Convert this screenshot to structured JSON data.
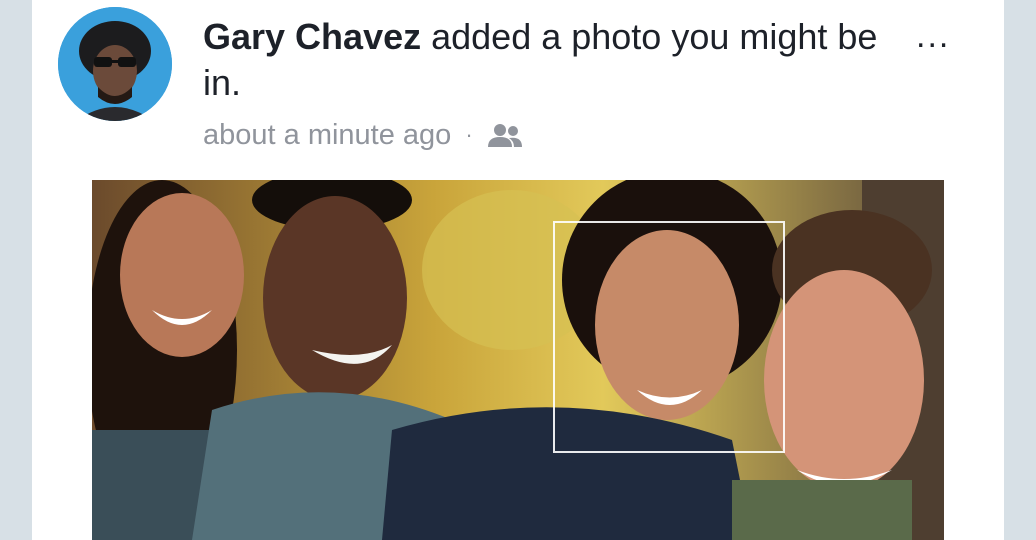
{
  "post": {
    "author_name": "Gary Chavez",
    "action_text": " added a photo you might be in.",
    "timestamp": "about a minute ago",
    "separator": "·",
    "audience_icon": "friends-icon",
    "more_label": "..."
  },
  "avatar": {
    "icon": "profile-photo"
  },
  "photo": {
    "icon": "group-photo-four-friends",
    "tag_box": "face-tag-box"
  },
  "colors": {
    "text_primary": "#1d2129",
    "text_secondary": "#90949c",
    "background": "#d7e0e6",
    "card": "#ffffff"
  }
}
